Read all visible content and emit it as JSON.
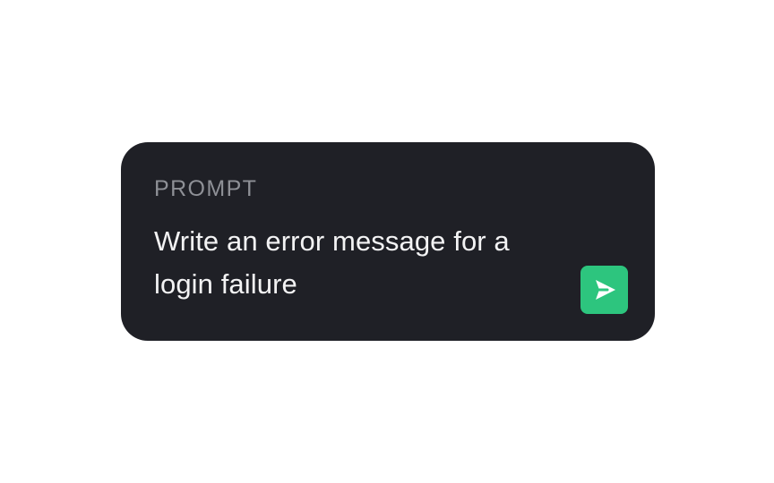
{
  "prompt": {
    "label": "PROMPT",
    "text": "Write an error message for a login failure",
    "send_icon": "send-arrow-icon",
    "send_button_color": "#2dc57e"
  },
  "colors": {
    "card_background": "#1f2026",
    "label": "#8e9096",
    "text": "#f3f3f4",
    "page_background": "#ffffff"
  }
}
